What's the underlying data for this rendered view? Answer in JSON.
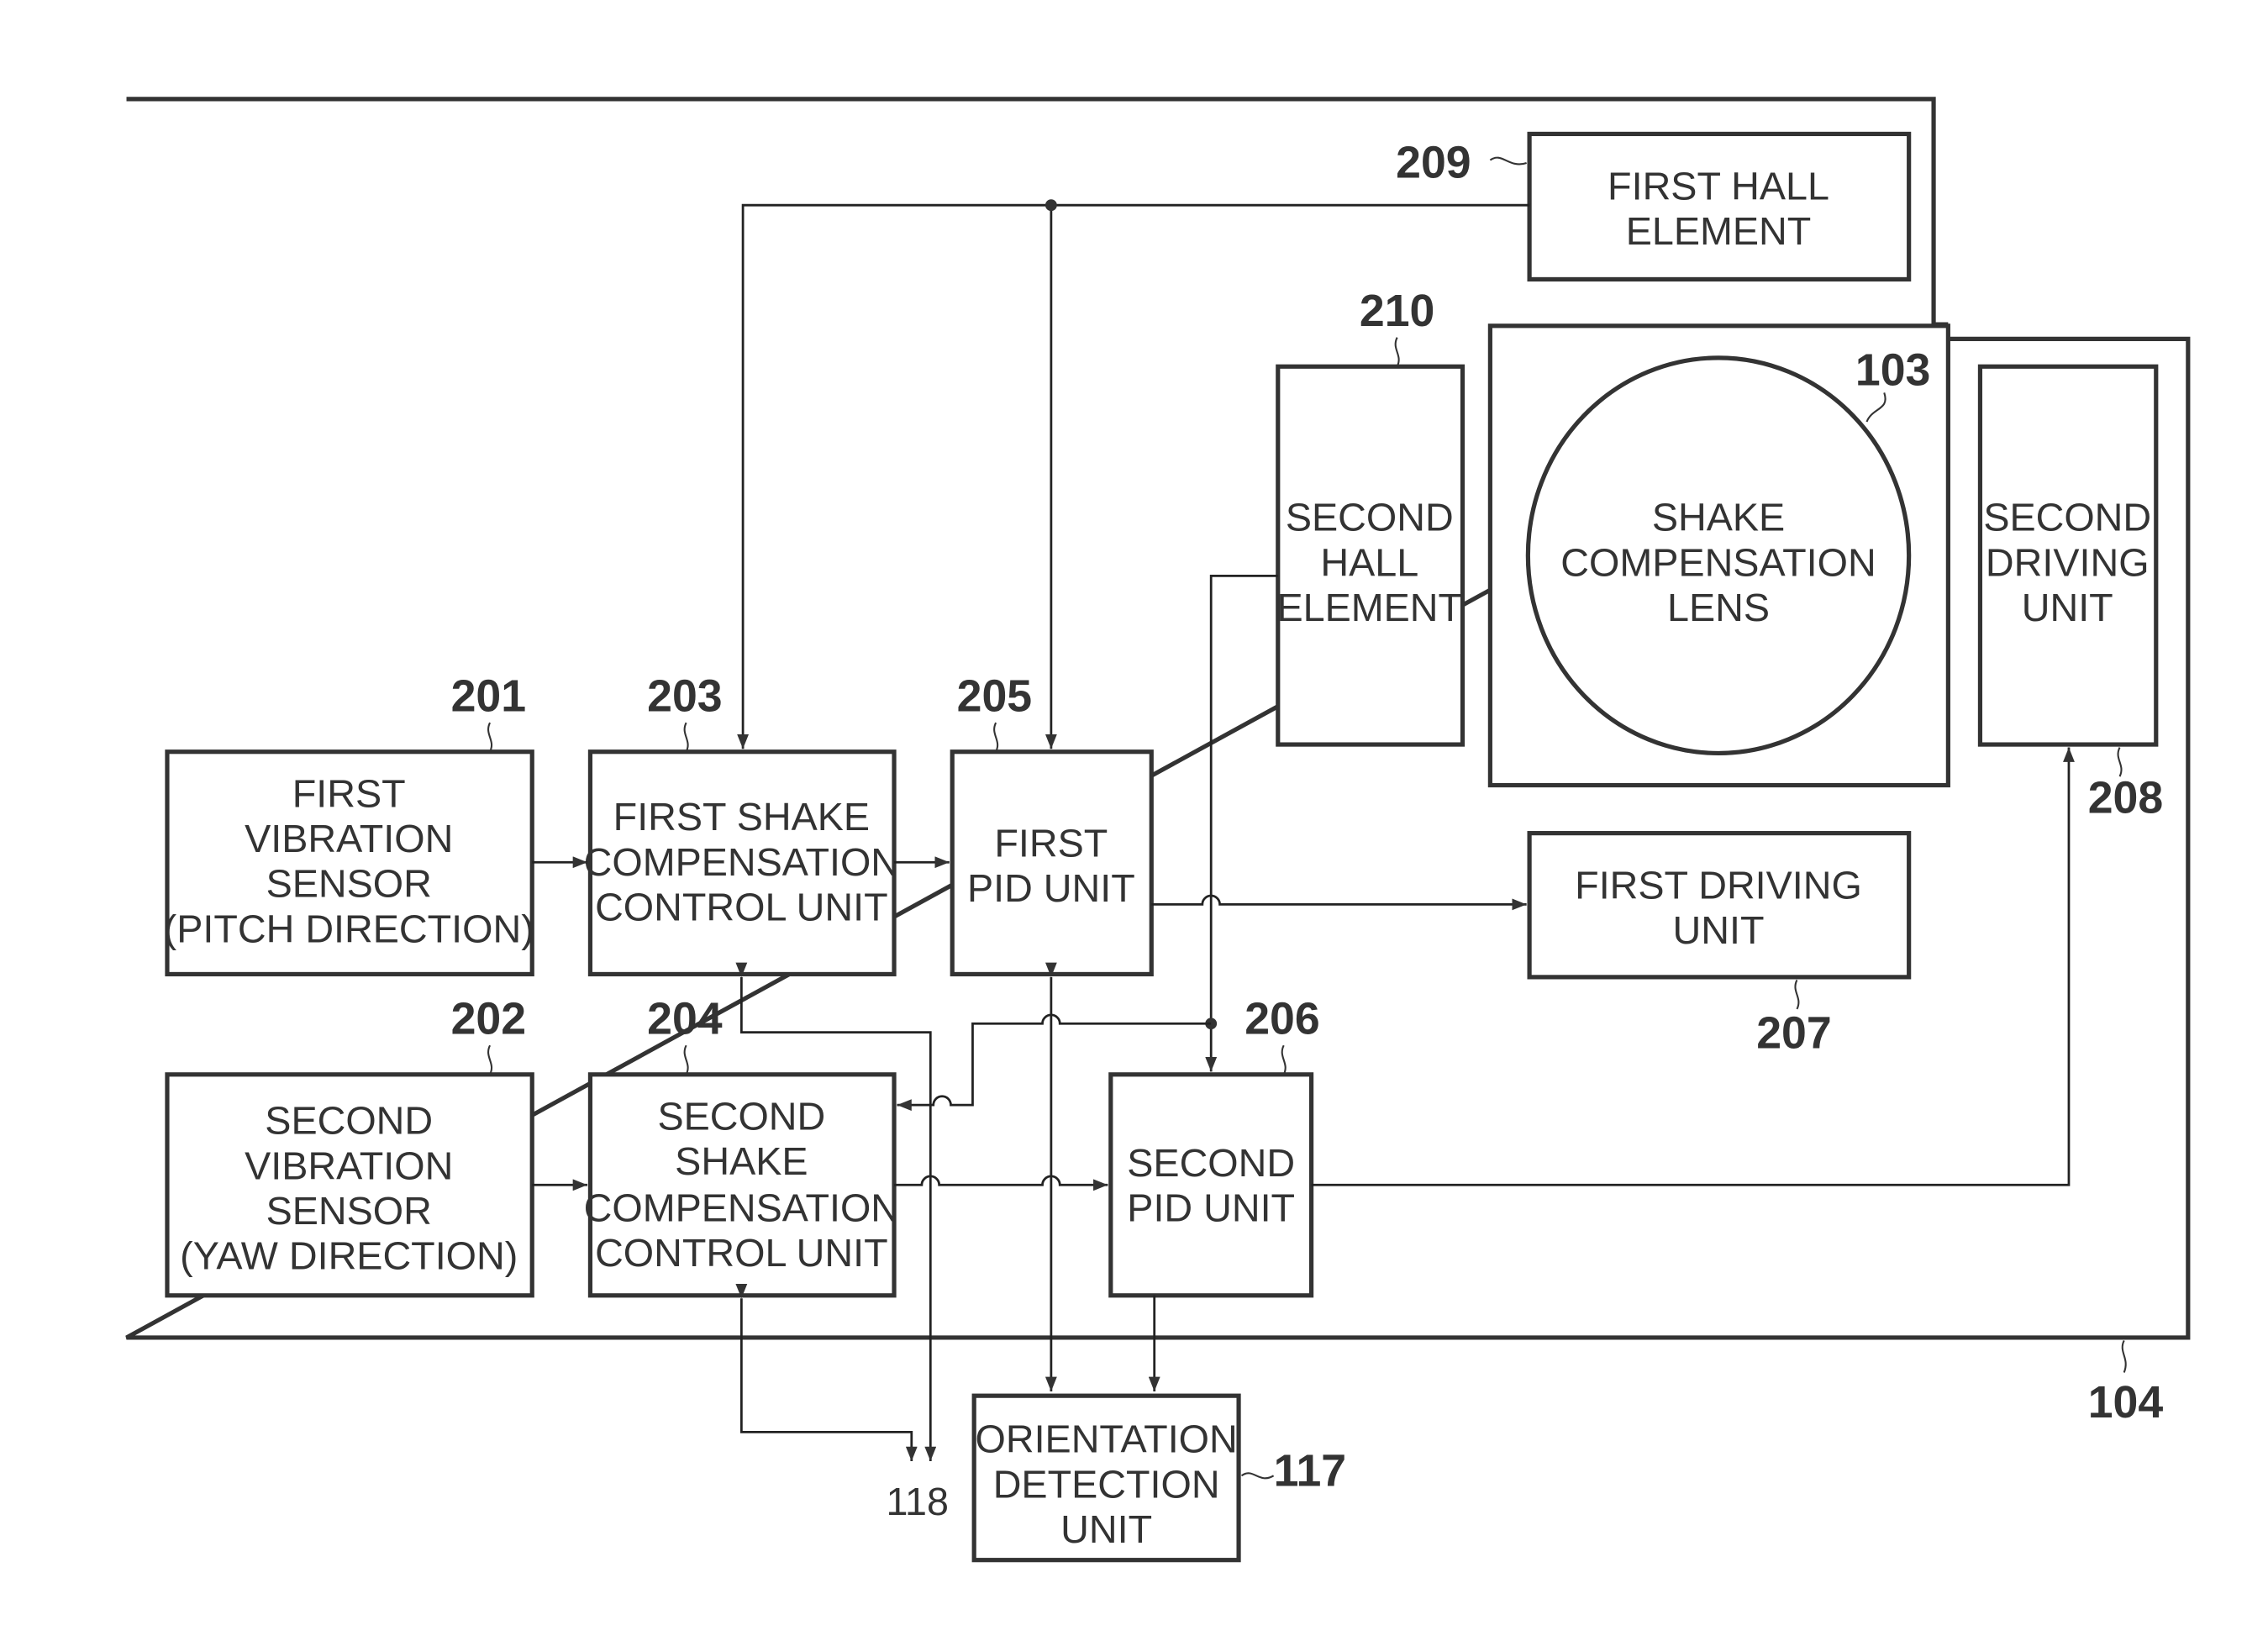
{
  "figure": {
    "enclosure_ref": "104",
    "blocks": {
      "first_vibration_sensor": {
        "ref": "201",
        "lines": [
          "FIRST",
          "VIBRATION",
          "SENSOR",
          "(PITCH DIRECTION)"
        ]
      },
      "second_vibration_sensor": {
        "ref": "202",
        "lines": [
          "SECOND",
          "VIBRATION",
          "SENSOR",
          "(YAW DIRECTION)"
        ]
      },
      "first_shake_control": {
        "ref": "203",
        "lines": [
          "FIRST SHAKE",
          "COMPENSATION",
          "CONTROL UNIT"
        ]
      },
      "second_shake_control": {
        "ref": "204",
        "lines": [
          "SECOND",
          "SHAKE",
          "COMPENSATION",
          "CONTROL UNIT"
        ]
      },
      "first_pid": {
        "ref": "205",
        "lines": [
          "FIRST",
          "PID UNIT"
        ]
      },
      "second_pid": {
        "ref": "206",
        "lines": [
          "SECOND",
          "PID UNIT"
        ]
      },
      "first_driving": {
        "ref": "207",
        "lines": [
          "FIRST DRIVING",
          "UNIT"
        ]
      },
      "second_driving": {
        "ref": "208",
        "lines": [
          "SECOND",
          "DRIVING",
          "UNIT"
        ]
      },
      "first_hall": {
        "ref": "209",
        "lines": [
          "FIRST HALL",
          "ELEMENT"
        ]
      },
      "second_hall": {
        "ref": "210",
        "lines": [
          "SECOND",
          "HALL",
          "ELEMENT"
        ]
      },
      "lens": {
        "ref": "103",
        "lines": [
          "SHAKE",
          "COMPENSATION",
          "LENS"
        ]
      },
      "orientation_detection": {
        "ref": "117",
        "lines": [
          "ORIENTATION",
          "DETECTION",
          "UNIT"
        ]
      }
    },
    "external_ref": "118"
  }
}
